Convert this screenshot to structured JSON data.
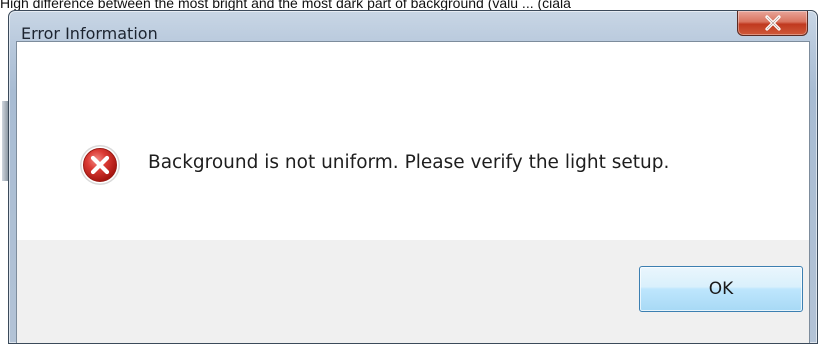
{
  "page_caption": "High difference between the most bright and the most dark part of background (valu ... (ciala",
  "dialog": {
    "title": "Error Information",
    "close_icon": "close-icon",
    "message": "Background is not uniform. Please verify the light setup.",
    "error_icon": "error-icon",
    "ok_label": "OK"
  },
  "colors": {
    "close_button": "#c0391f",
    "ok_button_border": "#3c7fb1",
    "error_icon": "#c9302c",
    "footer_bg": "#f0f0f0"
  }
}
